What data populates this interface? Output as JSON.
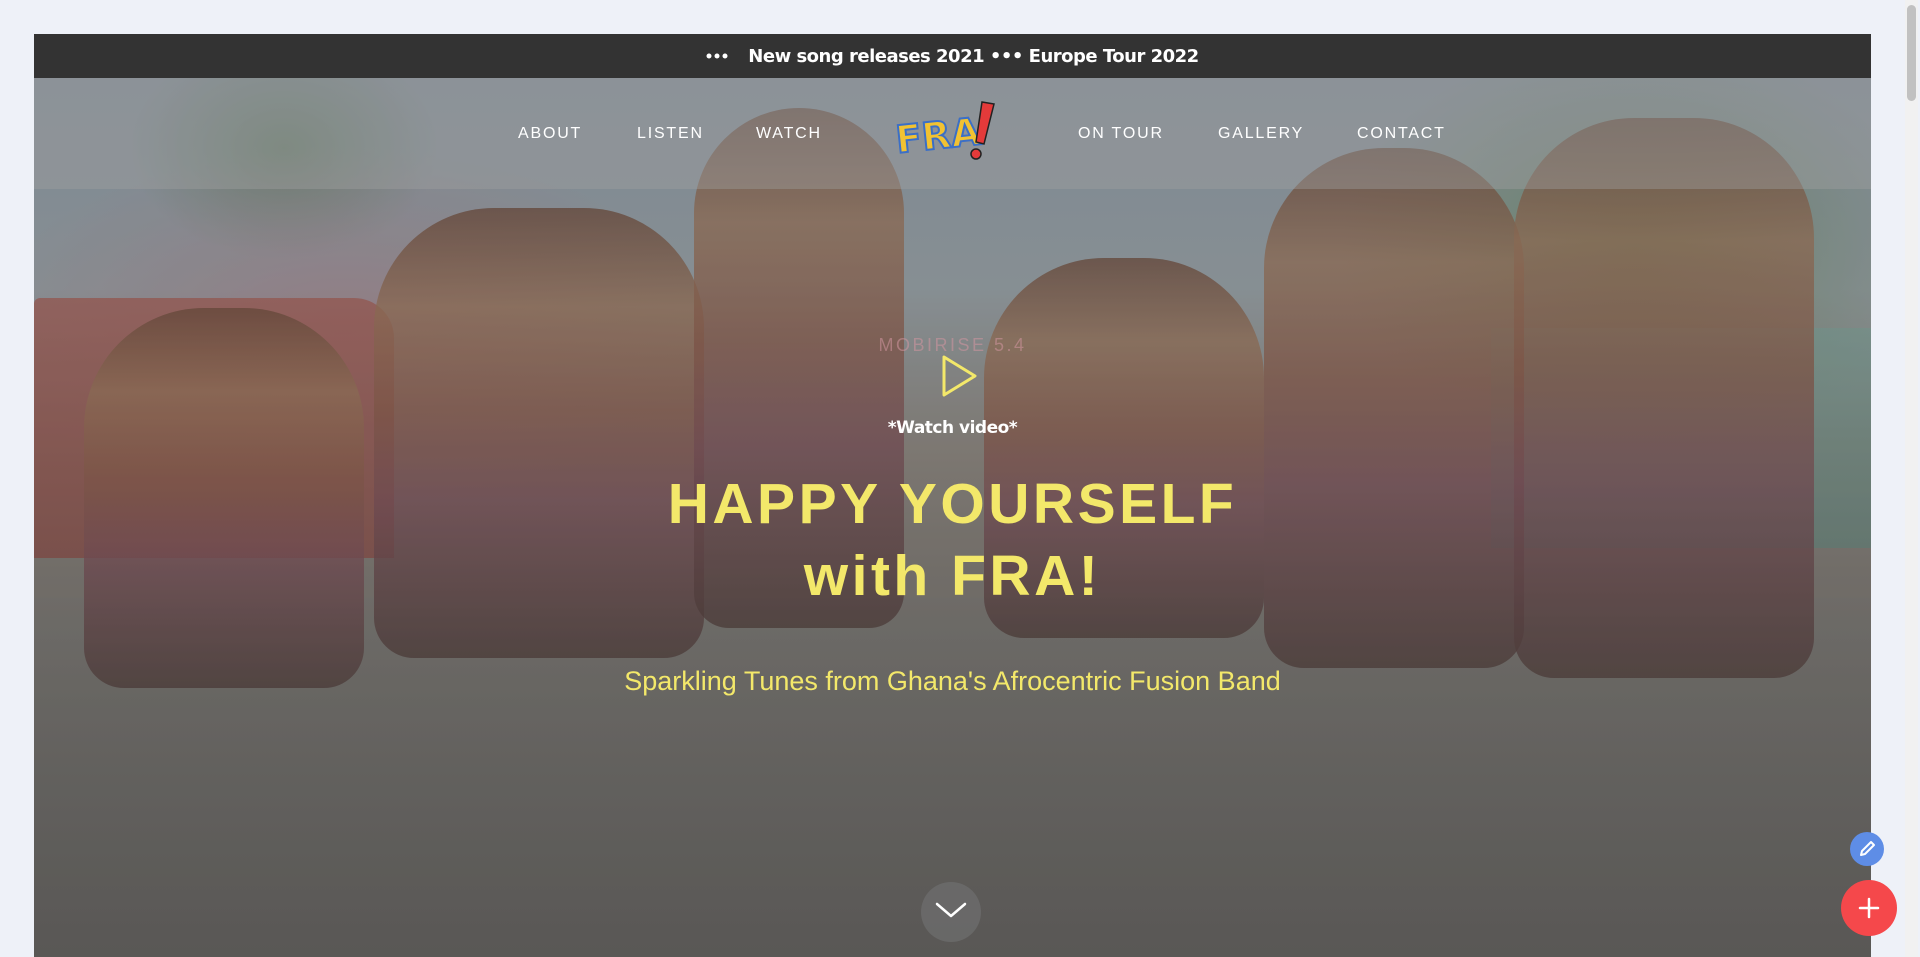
{
  "announcement": {
    "text": "New song releases 2021 ••• Europe Tour 2022",
    "icon": "dots-icon"
  },
  "nav": {
    "items": [
      {
        "label": "ABOUT"
      },
      {
        "label": "LISTEN"
      },
      {
        "label": "WATCH"
      },
      {
        "label": "ON TOUR"
      },
      {
        "label": "GALLERY"
      },
      {
        "label": "CONTACT"
      }
    ],
    "logo_text": "FRA!"
  },
  "hero": {
    "brand_text": "MOBIRISE 5.4",
    "watch_label": "*Watch video*",
    "headline_line1": "HAPPY YOURSELF",
    "headline_line2": "with FRA!",
    "subtitle": "Sparkling Tunes from Ghana's Afrocentric Fusion Band"
  },
  "colors": {
    "accent_yellow": "#f3e86a",
    "topbar": "#333333",
    "edit_button": "#5e8de6",
    "add_button": "#f5484b"
  },
  "icons": {
    "play": "play-icon",
    "scroll_down": "chevron-down-icon",
    "edit": "pencil-icon",
    "add": "plus-icon"
  }
}
